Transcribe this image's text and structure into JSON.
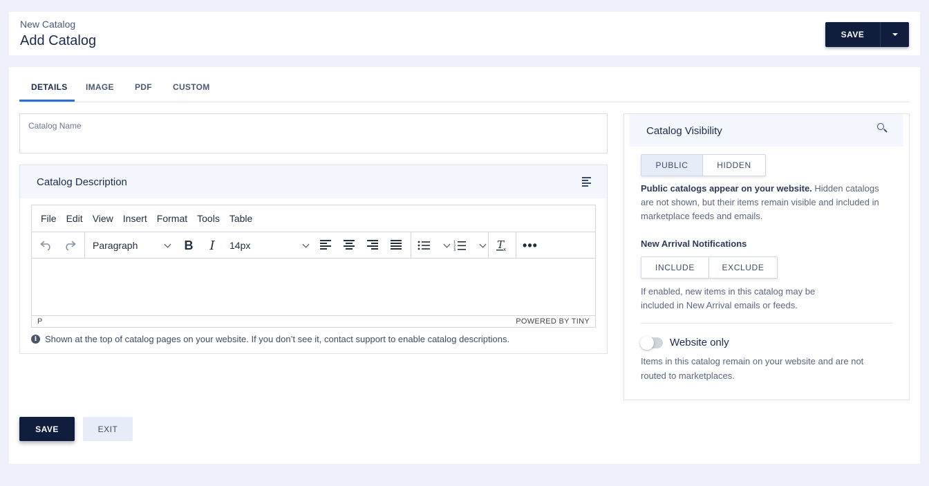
{
  "header": {
    "breadcrumb": "New Catalog",
    "title": "Add Catalog",
    "save_label": "SAVE",
    "dropdown_icon": "caret-down-icon"
  },
  "tabs": [
    {
      "label": "DETAILS",
      "active": true
    },
    {
      "label": "IMAGE",
      "active": false
    },
    {
      "label": "PDF",
      "active": false
    },
    {
      "label": "CUSTOM",
      "active": false
    }
  ],
  "catalog_name": {
    "label": "Catalog Name",
    "value": ""
  },
  "description": {
    "title": "Catalog Description",
    "menu": [
      "File",
      "Edit",
      "View",
      "Insert",
      "Format",
      "Tools",
      "Table"
    ],
    "toolbar": {
      "block_format": "Paragraph",
      "font_size": "14px"
    },
    "status_path": "P",
    "powered_by": "POWERED BY TINY",
    "hint": "Shown at the top of catalog pages on your website. If you don’t see it, contact support to enable catalog descriptions."
  },
  "visibility": {
    "title": "Catalog Visibility",
    "options": [
      "PUBLIC",
      "HIDDEN"
    ],
    "selected": "PUBLIC",
    "desc_bold": "Public catalogs appear on your website.",
    "desc_rest": " Hidden catalogs are not shown, but their items remain visible and included in marketplace feeds and emails.",
    "new_arrival_title": "New Arrival Notifications",
    "new_arrival_options": [
      "INCLUDE",
      "EXCLUDE"
    ],
    "new_arrival_desc": "If enabled, new items in this catalog may be included in New Arrival emails or feeds.",
    "website_only_label": "Website only",
    "website_only_on": false,
    "website_only_desc": "Items in this catalog remain on your website and are not routed to marketplaces."
  },
  "footer": {
    "save_label": "SAVE",
    "exit_label": "EXIT"
  },
  "colors": {
    "primary": "#101d3d",
    "accent": "#2e6ed1",
    "page_bg": "#eef1f9"
  }
}
